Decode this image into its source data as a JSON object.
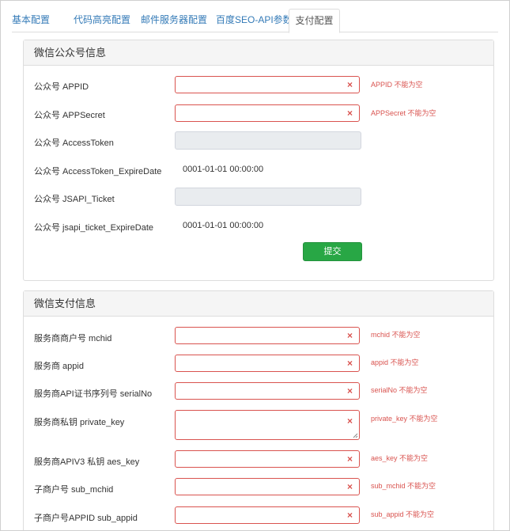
{
  "tabs": [
    {
      "label": "基本配置"
    },
    {
      "label": "代码高亮配置"
    },
    {
      "label": "邮件服务器配置"
    },
    {
      "label": "百度SEO-API参数"
    },
    {
      "label": "支付配置"
    }
  ],
  "wechat_public": {
    "title": "微信公众号信息",
    "appid": {
      "label": "公众号 APPID",
      "value": "",
      "error": "APPID 不能为空"
    },
    "appsecret": {
      "label": "公众号 APPSecret",
      "value": "",
      "error": "APPSecret 不能为空"
    },
    "access_token": {
      "label": "公众号 AccessToken",
      "value": ""
    },
    "access_token_expire": {
      "label": "公众号 AccessToken_ExpireDate",
      "value": "0001-01-01 00:00:00"
    },
    "jsapi_ticket": {
      "label": "公众号 JSAPI_Ticket",
      "value": ""
    },
    "jsapi_ticket_expire": {
      "label": "公众号 jsapi_ticket_ExpireDate",
      "value": "0001-01-01 00:00:00"
    },
    "submit_label": "提交"
  },
  "wechat_pay": {
    "title": "微信支付信息",
    "mchid": {
      "label": "服务商商户号 mchid",
      "value": "",
      "error": "mchid 不能为空"
    },
    "appid": {
      "label": "服务商 appid",
      "value": "",
      "error": "appid 不能为空"
    },
    "serial_no": {
      "label": "服务商API证书序列号 serialNo",
      "value": "",
      "error": "serialNo 不能为空"
    },
    "private_key": {
      "label": "服务商私钥 private_key",
      "value": "",
      "error": "private_key 不能为空"
    },
    "aes_key": {
      "label": "服务商APIV3 私钥 aes_key",
      "value": "",
      "error": "aes_key 不能为空"
    },
    "sub_mchid": {
      "label": "子商户号 sub_mchid",
      "value": "",
      "error": "sub_mchid 不能为空"
    },
    "sub_appid": {
      "label": "子商户号APPID sub_appid",
      "value": "",
      "error": "sub_appid 不能为空"
    }
  },
  "icons": {
    "clear": "×"
  },
  "colors": {
    "error": "#d9534f",
    "submit": "#28a745",
    "link": "#337ab7"
  }
}
